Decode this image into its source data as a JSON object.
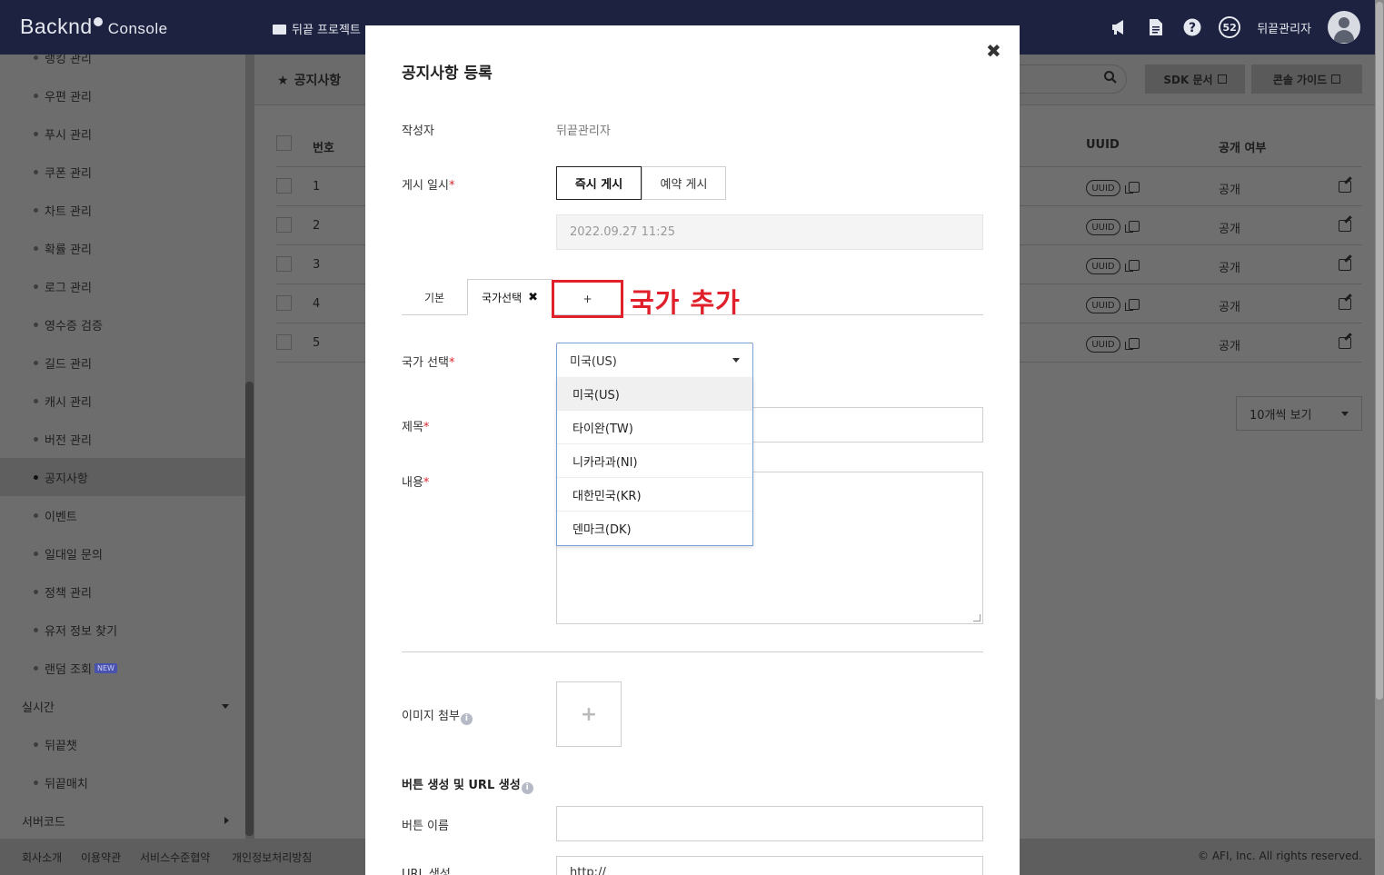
{
  "header": {
    "logo_main": "Backnd",
    "logo_sub": "Console",
    "project": "뒤끝 프로젝트",
    "notification_count": "52",
    "user_name": "뒤끝관리자"
  },
  "sidebar": {
    "items": [
      {
        "label": "랭킹 관리"
      },
      {
        "label": "우편 관리"
      },
      {
        "label": "푸시 관리"
      },
      {
        "label": "쿠폰 관리"
      },
      {
        "label": "차트 관리"
      },
      {
        "label": "확률 관리"
      },
      {
        "label": "로그 관리"
      },
      {
        "label": "영수증 검증"
      },
      {
        "label": "길드 관리"
      },
      {
        "label": "캐시 관리"
      },
      {
        "label": "버전 관리"
      },
      {
        "label": "공지사항",
        "active": true
      },
      {
        "label": "이벤트"
      },
      {
        "label": "일대일 문의"
      },
      {
        "label": "정책 관리"
      },
      {
        "label": "유저 정보 찾기"
      },
      {
        "label": "랜덤 조회",
        "badge": "NEW"
      }
    ],
    "section_realtime": "실시간",
    "realtime_items": [
      {
        "label": "뒤끝챗"
      },
      {
        "label": "뒤끝매치"
      }
    ],
    "section_servercode": "서버코드"
  },
  "page": {
    "breadcrumb": "공지사항",
    "sdk_button": "SDK 문서",
    "guide_button": "콘솔 가이드",
    "columns": {
      "no": "번호",
      "uuid": "UUID",
      "public": "공개 여부"
    },
    "rows": [
      {
        "no": "1",
        "uuid": "UUID",
        "public": "공개"
      },
      {
        "no": "2",
        "uuid": "UUID",
        "public": "공개"
      },
      {
        "no": "3",
        "uuid": "UUID",
        "public": "공개"
      },
      {
        "no": "4",
        "uuid": "UUID",
        "public": "공개"
      },
      {
        "no": "5",
        "uuid": "UUID",
        "public": "공개"
      }
    ],
    "per_page": "10개씩 보기"
  },
  "footer": {
    "links": [
      "회사소개",
      "이용약관",
      "서비스수준협약",
      "개인정보처리방침"
    ],
    "copyright": "© AFI, Inc. All rights reserved."
  },
  "modal": {
    "title": "공지사항 등록",
    "author_label": "작성자",
    "author_value": "뒤끝관리자",
    "post_time_label": "게시 일시",
    "post_now": "즉시 게시",
    "post_scheduled": "예약 게시",
    "datetime": "2022.09.27 11:25",
    "tab_basic": "기본",
    "tab_country": "국가선택",
    "tab_add": "+",
    "annotation": "국가 추가",
    "country_label": "국가 선택",
    "country_selected": "미국(US)",
    "country_options": [
      "미국(US)",
      "타이완(TW)",
      "니카라과(NI)",
      "대한민국(KR)",
      "덴마크(DK)"
    ],
    "title_label": "제목",
    "content_label": "내용",
    "image_label": "이미지 첨부",
    "image_add": "+",
    "button_section": "버튼 생성 및 URL 생성",
    "button_name_label": "버튼 이름",
    "url_label": "URL 생성",
    "url_value": "http://",
    "required_mark": "*"
  },
  "colors": {
    "header_bg": "#1d2240",
    "required": "#d9262f",
    "highlight": "#e0202b"
  }
}
